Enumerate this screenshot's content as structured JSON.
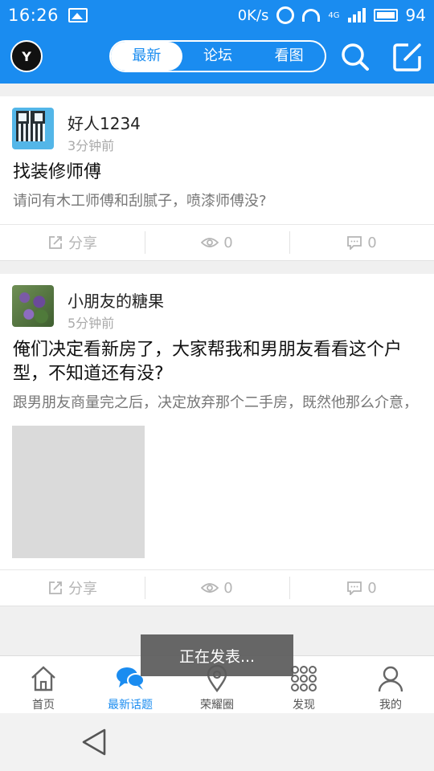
{
  "statusbar": {
    "time": "16:26",
    "data_speed": "0K/s",
    "network": "4G",
    "battery": "94"
  },
  "header": {
    "avatar_text": "Y",
    "tabs": [
      {
        "label": "最新",
        "active": true
      },
      {
        "label": "论坛",
        "active": false
      },
      {
        "label": "看图",
        "active": false
      }
    ],
    "accent_color": "#1a8cf0"
  },
  "posts": [
    {
      "author": "好人1234",
      "time_ago": "3分钟前",
      "title": "找装修师傅",
      "body": "请问有木工师傅和刮腻子，喷漆师傅没?",
      "has_image": false,
      "share_label": "分享",
      "views": "0",
      "comments": "0"
    },
    {
      "author": "小朋友的糖果",
      "time_ago": "5分钟前",
      "title": "俺们决定看新房了，大家帮我和男朋友看看这个户型，不知道还有没?",
      "body": "跟男朋友商量完之后，决定放弃那个二手房，既然他那么介意，",
      "has_image": true,
      "share_label": "分享",
      "views": "0",
      "comments": "0"
    }
  ],
  "toast": {
    "text": "正在发表..."
  },
  "bottom_nav": [
    {
      "label": "首页",
      "icon": "home-icon",
      "active": false
    },
    {
      "label": "最新话题",
      "icon": "chat-bubbles-icon",
      "active": true
    },
    {
      "label": "荣耀圈",
      "icon": "location-pin-icon",
      "active": false
    },
    {
      "label": "发现",
      "icon": "grid-dots-icon",
      "active": false
    },
    {
      "label": "我的",
      "icon": "user-icon",
      "active": false
    }
  ]
}
